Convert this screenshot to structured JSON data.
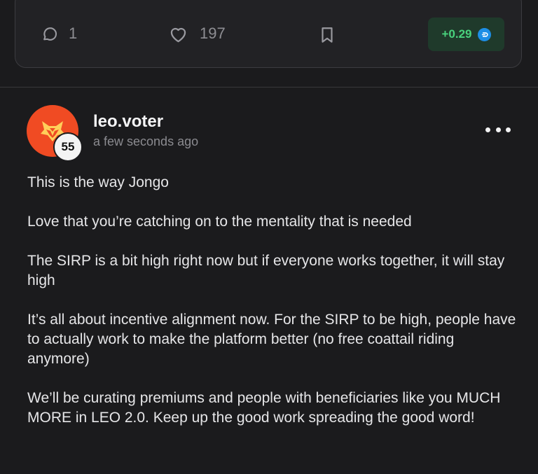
{
  "previous_post": {
    "comments_count": "1",
    "likes_count": "197",
    "reward_value": "+0.29",
    "reward_color": "#49d17d",
    "reward_background": "#1f3a2b",
    "icons": [
      "comment-icon",
      "heart-icon",
      "bookmark-icon",
      "hbd-coin-icon"
    ]
  },
  "comment": {
    "author": "leo.voter",
    "reputation": "55",
    "time": "a few seconds ago",
    "avatar_color": "#f04b23",
    "paragraphs": [
      "This is the way Jongo",
      "Love that you’re catching on to the mentality that is needed",
      "The SIRP is a bit high right now but if everyone works together, it will stay high",
      "It’s all about incentive alignment now. For the SIRP to be high, people have to actually work to make the platform better (no free coattail riding anymore)",
      "We’ll be curating premiums and people with beneficiaries like you MUCH MORE in LEO 2.0. Keep up the good work spreading the good word!"
    ]
  }
}
